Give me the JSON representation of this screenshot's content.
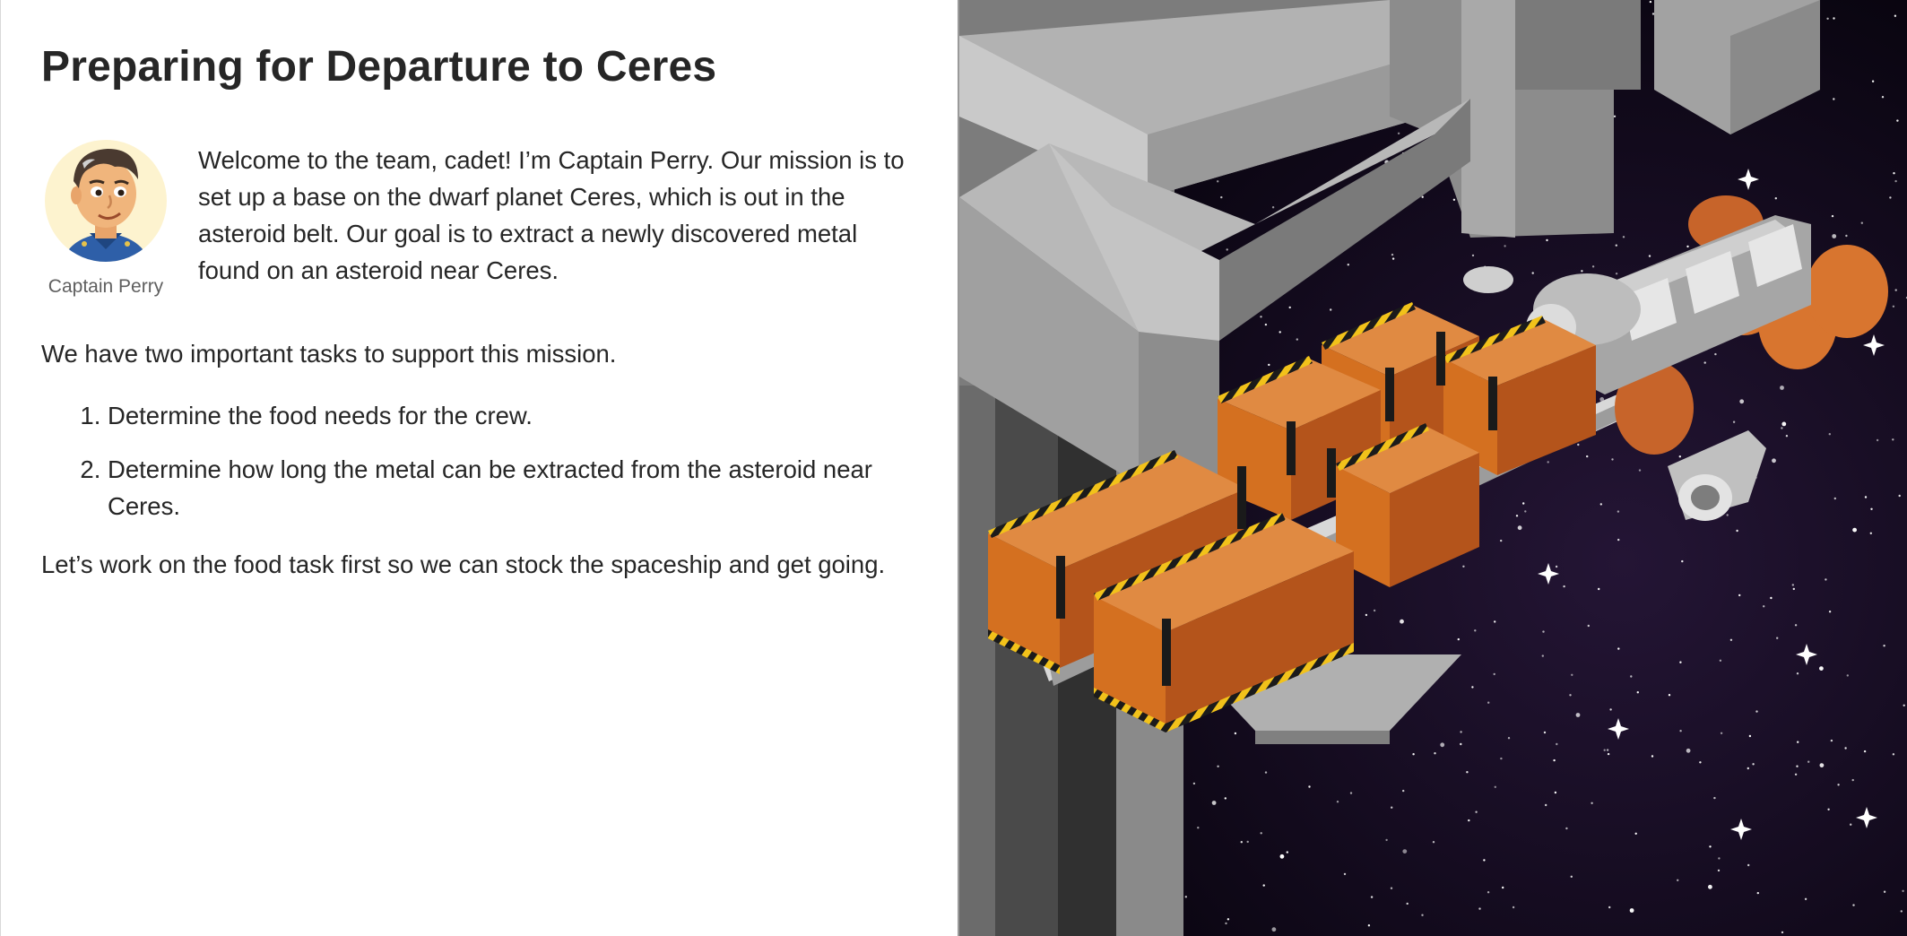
{
  "lesson": {
    "title": "Preparing for Departure to Ceres",
    "speaker": {
      "name": "Captain Perry",
      "icon": "captain-avatar"
    },
    "intro": "Welcome to the team, cadet! I’m Captain Perry. Our mission is to set up a base on the dwarf planet Ceres, which is out in the asteroid belt. Our goal is to extract a newly discovered metal found on an asteroid near Ceres.",
    "tasks_intro": "We have two important tasks to support this mission.",
    "tasks": [
      "Determine the food needs for the crew.",
      "Determine how long the metal can be extracted from the asteroid near Ceres."
    ],
    "closing": "Let’s work on the food task first so we can stock the spaceship and get going."
  },
  "illustration": {
    "subject": "spaceship-with-cargo-containers-icon",
    "colors": {
      "space": "#0c0614",
      "cargo": "#d4721f",
      "station": "#b9b9b9"
    }
  }
}
